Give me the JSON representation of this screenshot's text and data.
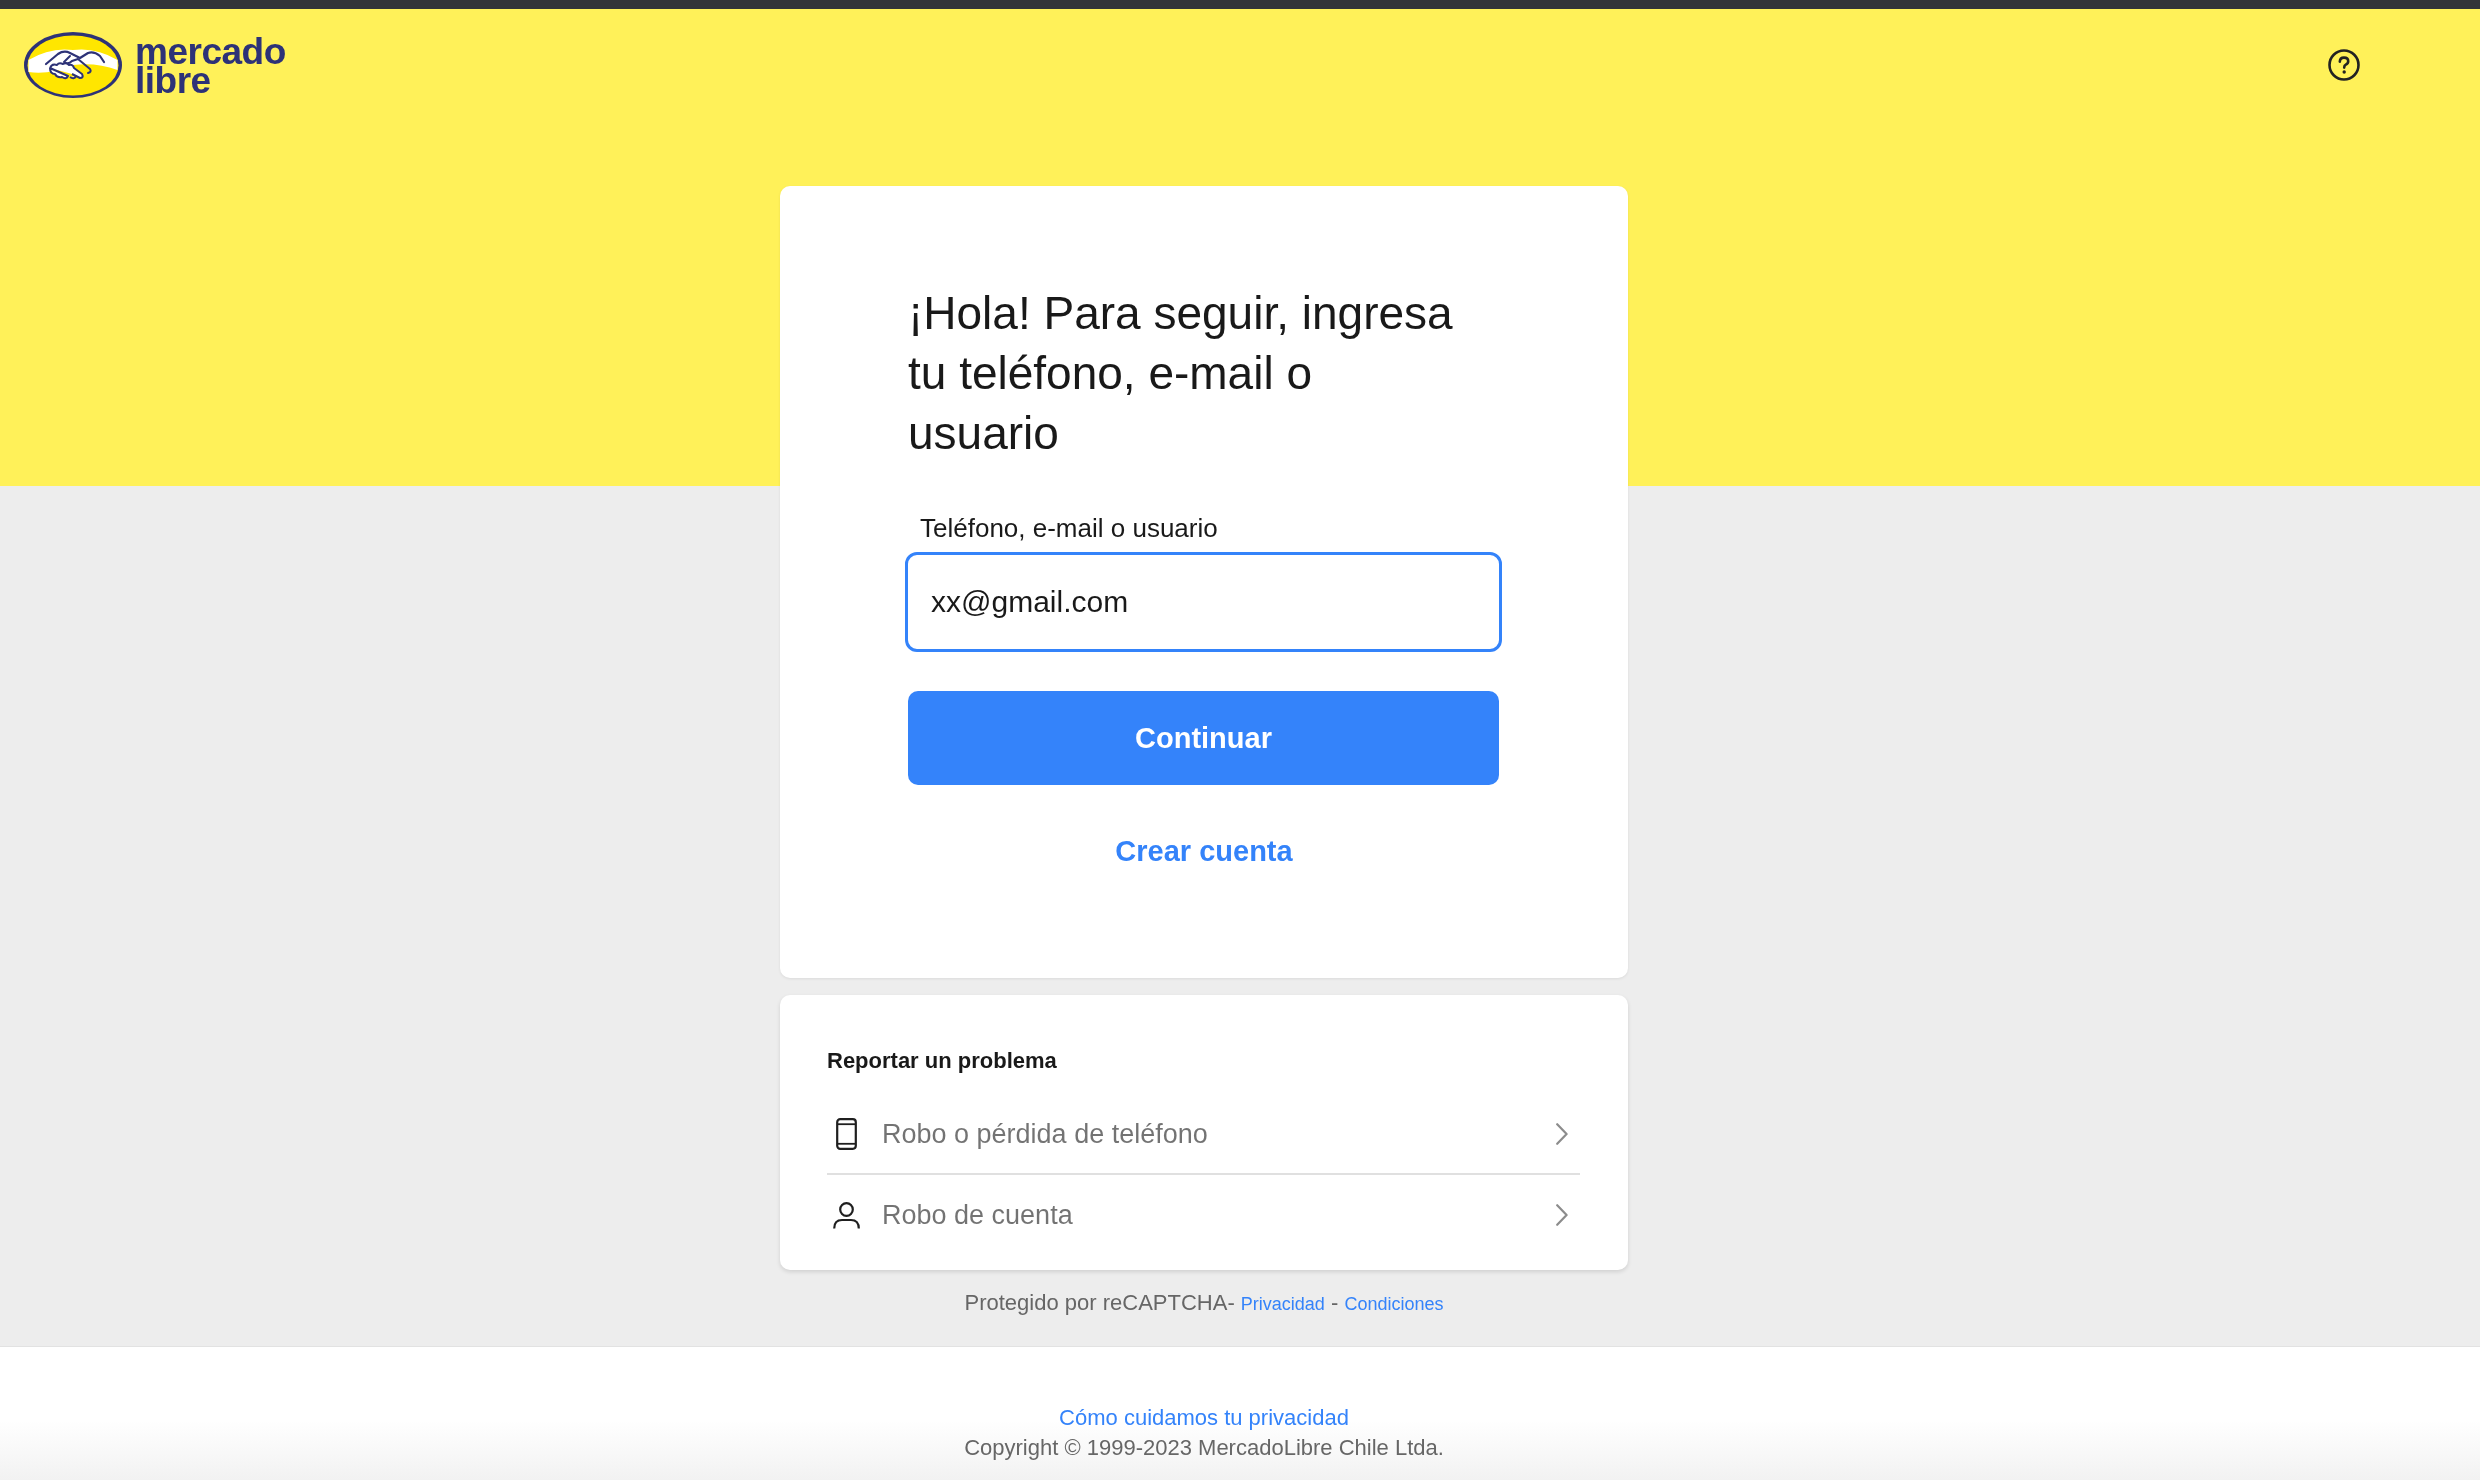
{
  "header": {
    "logo_lines": [
      "mercado",
      "libre"
    ]
  },
  "login_card": {
    "heading": "¡Hola! Para seguir, ingresa tu teléfono, e-mail o usuario",
    "field": {
      "label": "Teléfono, e-mail o usuario",
      "value": "xx@gmail.com",
      "focused": true
    },
    "continue_button": "Continuar",
    "create_account_link": "Crear cuenta"
  },
  "report_card": {
    "title": "Reportar un problema",
    "items": [
      {
        "kind": "phone",
        "label": "Robo o pérdida de teléfono"
      },
      {
        "kind": "account",
        "label": "Robo de cuenta"
      }
    ]
  },
  "recaptcha": {
    "text": "Protegido por reCAPTCHA-",
    "links": [
      "Privacidad",
      "Condiciones"
    ],
    "separator": "-"
  },
  "footer": {
    "privacy_link": "Cómo cuidamos tu privacidad",
    "copyright": "Copyright © 1999-2023 MercadoLibre Chile Ltda."
  }
}
